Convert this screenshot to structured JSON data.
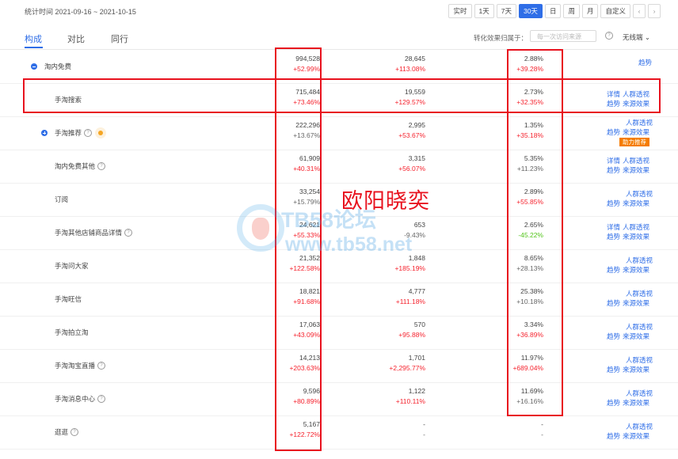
{
  "header": {
    "date_range": "统计时间 2021-09-16 ~ 2021-10-15",
    "buttons": [
      "实时",
      "1天",
      "7天",
      "30天",
      "日",
      "周",
      "月",
      "自定义"
    ],
    "active_button": "30天",
    "prev_icon": "‹",
    "next_icon": "›"
  },
  "tabs": [
    "构成",
    "对比",
    "同行"
  ],
  "attribution": {
    "label": "转化效果归属于：",
    "placeholder": "每一次访问来源",
    "wireless": "无线端"
  },
  "rows": [
    {
      "name": "淘内免费",
      "expand": "minus",
      "indent": 0,
      "help": false,
      "hot": false,
      "visitors": "994,528",
      "visitors_change": "+52.99%",
      "visitors_dir": "up",
      "buyers": "28,645",
      "buyers_change": "+113.08%",
      "buyers_dir": "up",
      "rate": "2.88%",
      "rate_change": "+39.28%",
      "rate_dir": "up",
      "links": [
        [
          "趋势"
        ]
      ],
      "badge": ""
    },
    {
      "name": "手淘搜索",
      "expand": "",
      "indent": 1,
      "help": false,
      "hot": false,
      "visitors": "715,484",
      "visitors_change": "+73.46%",
      "visitors_dir": "up",
      "buyers": "19,559",
      "buyers_change": "+129.57%",
      "buyers_dir": "up",
      "rate": "2.73%",
      "rate_change": "+32.35%",
      "rate_dir": "up",
      "links": [
        [
          "详情",
          "人群透视"
        ],
        [
          "趋势",
          "来源效果"
        ]
      ],
      "badge": ""
    },
    {
      "name": "手淘推荐",
      "expand": "plus",
      "indent": 1,
      "help": true,
      "hot": true,
      "visitors": "222,296",
      "visitors_change": "+13.67%",
      "visitors_dir": "plain",
      "buyers": "2,995",
      "buyers_change": "+53.67%",
      "buyers_dir": "up",
      "rate": "1.35%",
      "rate_change": "+35.18%",
      "rate_dir": "up",
      "links": [
        [
          "人群透视"
        ],
        [
          "趋势",
          "来源效果"
        ]
      ],
      "badge": "助力推荐"
    },
    {
      "name": "淘内免费其他",
      "expand": "",
      "indent": 1,
      "help": true,
      "hot": false,
      "visitors": "61,909",
      "visitors_change": "+40.31%",
      "visitors_dir": "up",
      "buyers": "3,315",
      "buyers_change": "+56.07%",
      "buyers_dir": "up",
      "rate": "5.35%",
      "rate_change": "+11.23%",
      "rate_dir": "plain",
      "links": [
        [
          "详情",
          "人群透视"
        ],
        [
          "趋势",
          "来源效果"
        ]
      ],
      "badge": ""
    },
    {
      "name": "订阅",
      "expand": "",
      "indent": 1,
      "help": false,
      "hot": false,
      "visitors": "33,254",
      "visitors_change": "+15.79%",
      "visitors_dir": "plain",
      "buyers": "",
      "buyers_change": "",
      "buyers_dir": "plain",
      "rate": "2.89%",
      "rate_change": "+55.85%",
      "rate_dir": "up",
      "links": [
        [
          "人群透视"
        ],
        [
          "趋势",
          "来源效果"
        ]
      ],
      "badge": ""
    },
    {
      "name": "手淘其他店铺商品详情",
      "expand": "",
      "indent": 1,
      "help": true,
      "hot": false,
      "visitors": "24,621",
      "visitors_change": "+55.33%",
      "visitors_dir": "up",
      "buyers": "653",
      "buyers_change": "-9.43%",
      "buyers_dir": "plain",
      "rate": "2.65%",
      "rate_change": "-45.22%",
      "rate_dir": "down",
      "links": [
        [
          "详情",
          "人群透视"
        ],
        [
          "趋势",
          "来源效果"
        ]
      ],
      "badge": ""
    },
    {
      "name": "手淘问大家",
      "expand": "",
      "indent": 1,
      "help": false,
      "hot": false,
      "visitors": "21,352",
      "visitors_change": "+122.58%",
      "visitors_dir": "up",
      "buyers": "1,848",
      "buyers_change": "+185.19%",
      "buyers_dir": "up",
      "rate": "8.65%",
      "rate_change": "+28.13%",
      "rate_dir": "plain",
      "links": [
        [
          "人群透视"
        ],
        [
          "趋势",
          "来源效果"
        ]
      ],
      "badge": ""
    },
    {
      "name": "手淘旺信",
      "expand": "",
      "indent": 1,
      "help": false,
      "hot": false,
      "visitors": "18,821",
      "visitors_change": "+91.68%",
      "visitors_dir": "up",
      "buyers": "4,777",
      "buyers_change": "+111.18%",
      "buyers_dir": "up",
      "rate": "25.38%",
      "rate_change": "+10.18%",
      "rate_dir": "plain",
      "links": [
        [
          "人群透视"
        ],
        [
          "趋势",
          "来源效果"
        ]
      ],
      "badge": ""
    },
    {
      "name": "手淘拍立淘",
      "expand": "",
      "indent": 1,
      "help": false,
      "hot": false,
      "visitors": "17,063",
      "visitors_change": "+43.09%",
      "visitors_dir": "up",
      "buyers": "570",
      "buyers_change": "+95.88%",
      "buyers_dir": "up",
      "rate": "3.34%",
      "rate_change": "+36.89%",
      "rate_dir": "up",
      "links": [
        [
          "人群透视"
        ],
        [
          "趋势",
          "来源效果"
        ]
      ],
      "badge": ""
    },
    {
      "name": "手淘淘宝直播",
      "expand": "",
      "indent": 1,
      "help": true,
      "hot": false,
      "visitors": "14,213",
      "visitors_change": "+203.63%",
      "visitors_dir": "up",
      "buyers": "1,701",
      "buyers_change": "+2,295.77%",
      "buyers_dir": "up",
      "rate": "11.97%",
      "rate_change": "+689.04%",
      "rate_dir": "up",
      "links": [
        [
          "人群透视"
        ],
        [
          "趋势",
          "来源效果"
        ]
      ],
      "badge": ""
    },
    {
      "name": "手淘消息中心",
      "expand": "",
      "indent": 1,
      "help": true,
      "hot": false,
      "visitors": "9,596",
      "visitors_change": "+80.89%",
      "visitors_dir": "up",
      "buyers": "1,122",
      "buyers_change": "+110.11%",
      "buyers_dir": "up",
      "rate": "11.69%",
      "rate_change": "+16.16%",
      "rate_dir": "plain",
      "links": [
        [
          "人群透视"
        ],
        [
          "趋势",
          "来源效果"
        ]
      ],
      "badge": ""
    },
    {
      "name": "逛逛",
      "expand": "",
      "indent": 1,
      "help": true,
      "hot": false,
      "visitors": "5,167",
      "visitors_change": "+122.72%",
      "visitors_dir": "up",
      "buyers": "-",
      "buyers_change": "-",
      "buyers_dir": "plain",
      "rate": "-",
      "rate_change": "-",
      "rate_dir": "plain",
      "links": [
        [
          "人群透视"
        ],
        [
          "趋势",
          "来源效果"
        ]
      ],
      "badge": ""
    }
  ],
  "watermark": {
    "annotation": "欧阳晓奕",
    "site_line1": "TB58论坛",
    "site_line2": "www.tb58.net"
  },
  "colors": {
    "accent": "#2f6ee7",
    "up": "#f5222d",
    "down": "#52c41a",
    "highlight_box": "#e8121e"
  }
}
